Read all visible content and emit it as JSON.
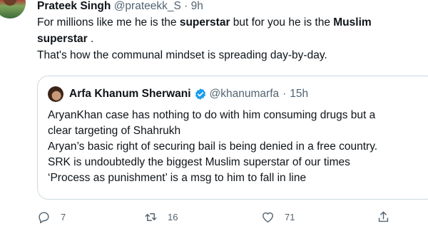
{
  "tweet": {
    "author_name": "Prateek Singh",
    "handle": "@prateekk_S",
    "separator": "·",
    "time": "9h",
    "text": {
      "line1_a": "For  millions  like me he  is the ",
      "line1_b": "superstar",
      "line1_c": " but for you he is the ",
      "line1_d": "Muslim",
      "line2_a": "superstar",
      "line2_b": " .",
      "line3": "That's how the communal mindset is spreading day-by-day."
    }
  },
  "quoted_tweet": {
    "author_name": "Arfa Khanum Sherwani",
    "handle": "@khanumarfa",
    "separator": "·",
    "time": "15h",
    "lines": [
      "AryanKhan case has nothing to do with him consuming drugs but a",
      "clear targeting of Shahrukh",
      "Aryan’s basic right of securing bail is being denied in a free country.",
      "SRK is undoubtedly the biggest Muslim superstar of our times",
      "‘Process as punishment’ is a msg to him to fall in line"
    ]
  },
  "actions": {
    "reply_count": "7",
    "retweet_count": "16",
    "like_count": "71"
  },
  "icons": {
    "verified": "verified-badge-icon",
    "reply": "reply-icon",
    "retweet": "retweet-icon",
    "like": "heart-icon",
    "share": "share-icon"
  },
  "colors": {
    "text": "#0f1419",
    "secondary": "#536471",
    "border": "#cfd9de",
    "verified": "#1d9bf0"
  }
}
